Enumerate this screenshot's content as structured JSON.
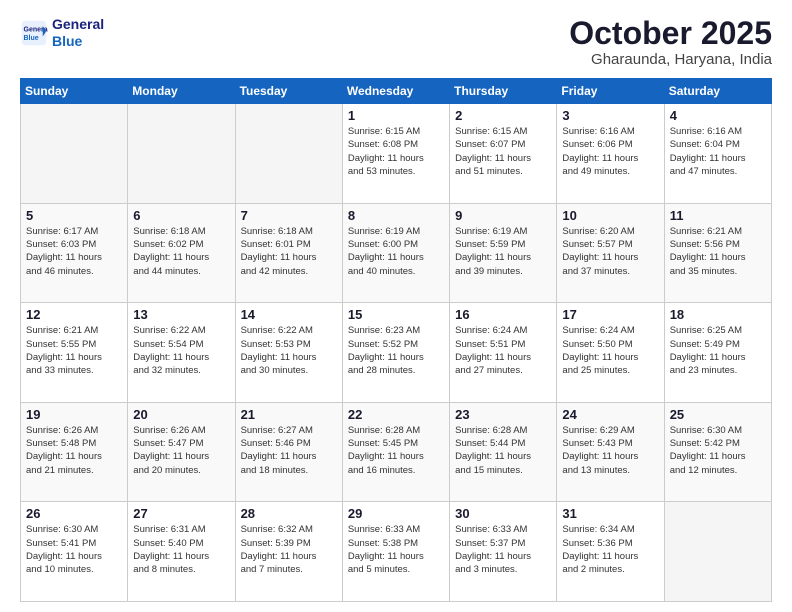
{
  "logo": {
    "line1": "General",
    "line2": "Blue"
  },
  "title": "October 2025",
  "location": "Gharaunda, Haryana, India",
  "days_of_week": [
    "Sunday",
    "Monday",
    "Tuesday",
    "Wednesday",
    "Thursday",
    "Friday",
    "Saturday"
  ],
  "weeks": [
    [
      {
        "day": "",
        "info": ""
      },
      {
        "day": "",
        "info": ""
      },
      {
        "day": "",
        "info": ""
      },
      {
        "day": "1",
        "info": "Sunrise: 6:15 AM\nSunset: 6:08 PM\nDaylight: 11 hours\nand 53 minutes."
      },
      {
        "day": "2",
        "info": "Sunrise: 6:15 AM\nSunset: 6:07 PM\nDaylight: 11 hours\nand 51 minutes."
      },
      {
        "day": "3",
        "info": "Sunrise: 6:16 AM\nSunset: 6:06 PM\nDaylight: 11 hours\nand 49 minutes."
      },
      {
        "day": "4",
        "info": "Sunrise: 6:16 AM\nSunset: 6:04 PM\nDaylight: 11 hours\nand 47 minutes."
      }
    ],
    [
      {
        "day": "5",
        "info": "Sunrise: 6:17 AM\nSunset: 6:03 PM\nDaylight: 11 hours\nand 46 minutes."
      },
      {
        "day": "6",
        "info": "Sunrise: 6:18 AM\nSunset: 6:02 PM\nDaylight: 11 hours\nand 44 minutes."
      },
      {
        "day": "7",
        "info": "Sunrise: 6:18 AM\nSunset: 6:01 PM\nDaylight: 11 hours\nand 42 minutes."
      },
      {
        "day": "8",
        "info": "Sunrise: 6:19 AM\nSunset: 6:00 PM\nDaylight: 11 hours\nand 40 minutes."
      },
      {
        "day": "9",
        "info": "Sunrise: 6:19 AM\nSunset: 5:59 PM\nDaylight: 11 hours\nand 39 minutes."
      },
      {
        "day": "10",
        "info": "Sunrise: 6:20 AM\nSunset: 5:57 PM\nDaylight: 11 hours\nand 37 minutes."
      },
      {
        "day": "11",
        "info": "Sunrise: 6:21 AM\nSunset: 5:56 PM\nDaylight: 11 hours\nand 35 minutes."
      }
    ],
    [
      {
        "day": "12",
        "info": "Sunrise: 6:21 AM\nSunset: 5:55 PM\nDaylight: 11 hours\nand 33 minutes."
      },
      {
        "day": "13",
        "info": "Sunrise: 6:22 AM\nSunset: 5:54 PM\nDaylight: 11 hours\nand 32 minutes."
      },
      {
        "day": "14",
        "info": "Sunrise: 6:22 AM\nSunset: 5:53 PM\nDaylight: 11 hours\nand 30 minutes."
      },
      {
        "day": "15",
        "info": "Sunrise: 6:23 AM\nSunset: 5:52 PM\nDaylight: 11 hours\nand 28 minutes."
      },
      {
        "day": "16",
        "info": "Sunrise: 6:24 AM\nSunset: 5:51 PM\nDaylight: 11 hours\nand 27 minutes."
      },
      {
        "day": "17",
        "info": "Sunrise: 6:24 AM\nSunset: 5:50 PM\nDaylight: 11 hours\nand 25 minutes."
      },
      {
        "day": "18",
        "info": "Sunrise: 6:25 AM\nSunset: 5:49 PM\nDaylight: 11 hours\nand 23 minutes."
      }
    ],
    [
      {
        "day": "19",
        "info": "Sunrise: 6:26 AM\nSunset: 5:48 PM\nDaylight: 11 hours\nand 21 minutes."
      },
      {
        "day": "20",
        "info": "Sunrise: 6:26 AM\nSunset: 5:47 PM\nDaylight: 11 hours\nand 20 minutes."
      },
      {
        "day": "21",
        "info": "Sunrise: 6:27 AM\nSunset: 5:46 PM\nDaylight: 11 hours\nand 18 minutes."
      },
      {
        "day": "22",
        "info": "Sunrise: 6:28 AM\nSunset: 5:45 PM\nDaylight: 11 hours\nand 16 minutes."
      },
      {
        "day": "23",
        "info": "Sunrise: 6:28 AM\nSunset: 5:44 PM\nDaylight: 11 hours\nand 15 minutes."
      },
      {
        "day": "24",
        "info": "Sunrise: 6:29 AM\nSunset: 5:43 PM\nDaylight: 11 hours\nand 13 minutes."
      },
      {
        "day": "25",
        "info": "Sunrise: 6:30 AM\nSunset: 5:42 PM\nDaylight: 11 hours\nand 12 minutes."
      }
    ],
    [
      {
        "day": "26",
        "info": "Sunrise: 6:30 AM\nSunset: 5:41 PM\nDaylight: 11 hours\nand 10 minutes."
      },
      {
        "day": "27",
        "info": "Sunrise: 6:31 AM\nSunset: 5:40 PM\nDaylight: 11 hours\nand 8 minutes."
      },
      {
        "day": "28",
        "info": "Sunrise: 6:32 AM\nSunset: 5:39 PM\nDaylight: 11 hours\nand 7 minutes."
      },
      {
        "day": "29",
        "info": "Sunrise: 6:33 AM\nSunset: 5:38 PM\nDaylight: 11 hours\nand 5 minutes."
      },
      {
        "day": "30",
        "info": "Sunrise: 6:33 AM\nSunset: 5:37 PM\nDaylight: 11 hours\nand 3 minutes."
      },
      {
        "day": "31",
        "info": "Sunrise: 6:34 AM\nSunset: 5:36 PM\nDaylight: 11 hours\nand 2 minutes."
      },
      {
        "day": "",
        "info": ""
      }
    ]
  ]
}
